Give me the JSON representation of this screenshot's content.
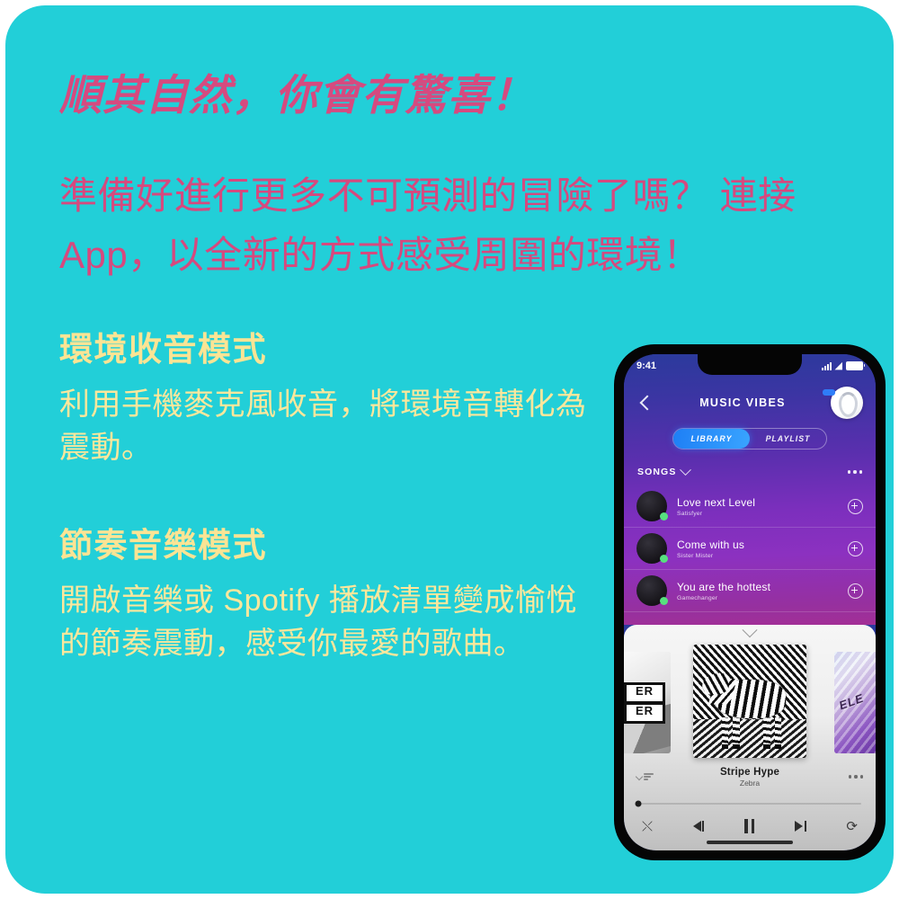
{
  "theme": {
    "card_bg": "#22CFD8",
    "headline_color": "#D64A7F",
    "section_color": "#FBE494",
    "body_color": "#FCE79C"
  },
  "copy": {
    "headline": "順其自然，你會有驚喜！",
    "subhead": "準備好進行更多不可預測的冒險了嗎？ 連接 App，以全新的方式感受周圍的環境！",
    "sections": [
      {
        "title": "環境收音模式",
        "body": "利用手機麥克風收音，將環境音轉化為震動。"
      },
      {
        "title": "節奏音樂模式",
        "body": "開啟音樂或 Spotify 播放清單變成愉悅的節奏震動，感受你最愛的歌曲。"
      }
    ]
  },
  "phone": {
    "status": {
      "time": "9:41",
      "signal_icon": "cellular-signal-icon",
      "wifi_icon": "wifi-icon",
      "battery_icon": "battery-icon"
    },
    "nav": {
      "back_icon": "chevron-left-icon",
      "title": "MUSIC VIBES",
      "device_icon": "bluetooth-device-icon"
    },
    "tabs": [
      {
        "label": "LIBRARY",
        "active": true
      },
      {
        "label": "PLAYLIST",
        "active": false
      }
    ],
    "list_header": {
      "label": "SONGS",
      "chevron_icon": "chevron-down-icon",
      "more_icon": "more-horizontal-icon"
    },
    "songs": [
      {
        "title": "Love next Level",
        "artist": "Satisfyer",
        "add_icon": "plus-circle-icon"
      },
      {
        "title": "Come with us",
        "artist": "Sister Mister",
        "add_icon": "plus-circle-icon"
      },
      {
        "title": "You are the hottest",
        "artist": "Gamechanger",
        "add_icon": "plus-circle-icon"
      }
    ],
    "player": {
      "pull_icon": "chevron-down-icon",
      "artwork_left_text": "ER",
      "artwork_left_text2": "ER",
      "artwork_right_text": "ELE",
      "now_playing_title": "Stripe Hype",
      "now_playing_artist": "Zebra",
      "equalizer_icon": "equalizer-icon",
      "more_icon": "more-horizontal-icon",
      "progress_percent": 0,
      "controls": {
        "shuffle_icon": "shuffle-icon",
        "previous_icon": "previous-track-icon",
        "pause_icon": "pause-icon",
        "next_icon": "next-track-icon",
        "repeat_icon": "repeat-icon"
      },
      "shuffle_glyph": "⤬",
      "repeat_glyph": "⟳"
    }
  }
}
